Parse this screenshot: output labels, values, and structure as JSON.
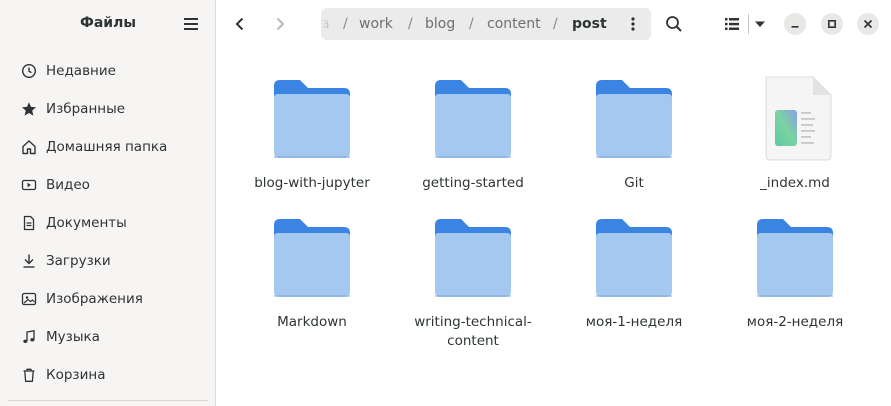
{
  "sidebar": {
    "title": "Файлы",
    "items": [
      {
        "label": "Недавние",
        "icon": "clock-icon"
      },
      {
        "label": "Избранные",
        "icon": "star-icon"
      },
      {
        "label": "Домашняя папка",
        "icon": "home-icon"
      },
      {
        "label": "Видео",
        "icon": "video-icon"
      },
      {
        "label": "Документы",
        "icon": "document-icon"
      },
      {
        "label": "Загрузки",
        "icon": "download-icon"
      },
      {
        "label": "Изображения",
        "icon": "image-icon"
      },
      {
        "label": "Музыка",
        "icon": "music-icon"
      },
      {
        "label": "Корзина",
        "icon": "trash-icon"
      }
    ]
  },
  "path": {
    "partial": "a",
    "crumbs": [
      "work",
      "blog",
      "content"
    ],
    "current": "post",
    "separator": "/"
  },
  "files": [
    {
      "name": "blog-with-jupyter",
      "type": "folder"
    },
    {
      "name": "getting-started",
      "type": "folder"
    },
    {
      "name": "Git",
      "type": "folder"
    },
    {
      "name": "_index.md",
      "type": "markdown"
    },
    {
      "name": "Markdown",
      "type": "folder"
    },
    {
      "name": "writing-technical-\ncontent",
      "type": "folder"
    },
    {
      "name": "моя-1-неделя",
      "type": "folder"
    },
    {
      "name": "моя-2-неделя",
      "type": "folder"
    }
  ],
  "colors": {
    "folder_back": "#3c84e4",
    "folder_front": "#a4c8f0",
    "sidebar_bg": "#f6f5f4",
    "pathbar_bg": "#ebebeb"
  }
}
